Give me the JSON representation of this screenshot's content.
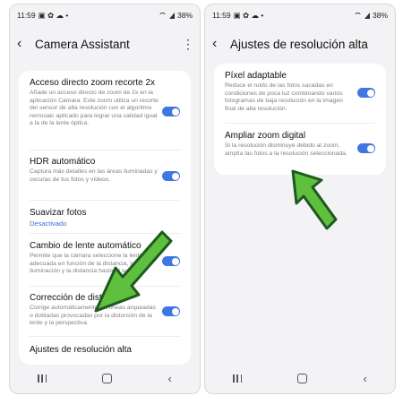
{
  "status_bar": {
    "time": "11:59",
    "battery": "38%"
  },
  "left_screen": {
    "title": "Camera Assistant",
    "items": [
      {
        "title": "Acceso directo zoom recorte 2x",
        "description": "Añade un acceso directo de zoom de 2x en la aplicación Cámara. Este zoom utiliza un recorte del sensor de alta resolución con el algoritmo remosaic aplicado para lograr una calidad igual a la de la lente óptica.",
        "toggle": true
      },
      {
        "title": "HDR automático",
        "description": "Captura más detalles en las áreas iluminadas y oscuras de tus fotos y vídeos.",
        "toggle": true
      },
      {
        "title": "Suavizar fotos",
        "subtitle": "Desactivado"
      },
      {
        "title": "Cambio de lente automático",
        "description": "Permite que la cámara seleccione la lente más adecuada en función de la distancia, la iluminación y la distancia hasta el sujeto.",
        "toggle": true
      },
      {
        "title": "Corrección de distorsión",
        "description": "Corrige automáticamente las líneas arqueadas o dobladas provocadas por la distorsión de la lente y la perspectiva.",
        "toggle": true
      },
      {
        "title": "Ajustes de resolución alta"
      }
    ]
  },
  "right_screen": {
    "title": "Ajustes de resolución alta",
    "items": [
      {
        "title": "Píxel adaptable",
        "description": "Reduce el ruido de las fotos sacadas en condiciones de poca luz combinando varios fotogramas de baja resolución en la imagen final de alta resolución.",
        "toggle": true
      },
      {
        "title": "Ampliar zoom digital",
        "description": "Si la resolución disminuye debido al zoom, amplía las fotos a la resolución seleccionada.",
        "toggle": true
      }
    ]
  },
  "colors": {
    "accent": "#3e77e2",
    "arrow_fill": "#5fbf3f",
    "arrow_stroke": "#1e5a1e",
    "background": "#f3f3f6"
  },
  "icons": [
    "back-icon",
    "more-options-icon",
    "recents-icon",
    "home-icon",
    "nav-back-icon",
    "wifi-icon",
    "signal-icon"
  ]
}
